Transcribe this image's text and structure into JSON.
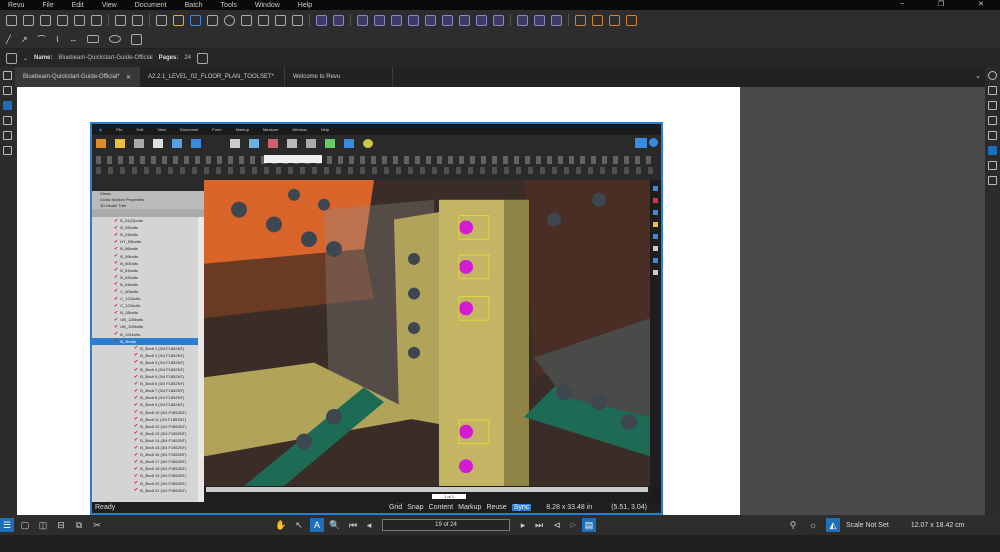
{
  "menu": [
    "Revu",
    "File",
    "Edit",
    "View",
    "Document",
    "Batch",
    "Tools",
    "Window",
    "Help"
  ],
  "file": {
    "name_label": "Name:",
    "name": "Bluebeam-Quickstart-Guide-Official",
    "pages_label": "Pages:",
    "pages": "24"
  },
  "tabs": [
    {
      "label": "Bluebeam-Quickstart-Guide-Official*",
      "close": "✕"
    },
    {
      "label": "A2.2.1_LEVEL_02_FLOOR_PLAN_TOOLSET*"
    },
    {
      "label": "Welcome to Revu"
    }
  ],
  "embedded": {
    "menu": [
      "File",
      "Edit",
      "View",
      "Document",
      "Form",
      "Markup",
      "Measure",
      "Window",
      "Help"
    ],
    "panel_sections": [
      "Views",
      "Cross Section Properties",
      "3D Model Tree"
    ],
    "view_tab": "Model1001b",
    "tree": [
      "B_51(2)bolts",
      "B_52bolts",
      "B_53bolts",
      "HY_55bolts",
      "B_56bolts",
      "B_59bolts",
      "B_60bolts",
      "B_61bolts",
      "B_62bolts",
      "B_63bolts",
      "C_60bolts",
      "C_121bolts",
      "C_122bolts",
      "B_28bolts",
      "UB_128bolts",
      "UB_109bolts",
      "B_191bolts",
      "B_3bolts"
    ],
    "subtree": [
      "B_3bolt 1 (3/4 F1852NT)",
      "B_3bolt 2 (3/4 F1852NT)",
      "B_3bolt 3 (3/4 F1852NT)",
      "B_3bolt 4 (3/4 F1852NT)",
      "B_3bolt 5 (3/4 F1852NT)",
      "B_3bolt 6 (3/4 F1852NT)",
      "B_3bolt 7 (3/4 F1852NT)",
      "B_3bolt 8 (3/4 F1852NT)",
      "B_3bolt 9 (3/4 F1852NT)",
      "B_3bolt 10 (3/4 F1852NT)",
      "B_3bolt 11 (3/4 F1852NT)",
      "B_3bolt 12 (3/4 F1852NT)",
      "B_3bolt 13 (3/4 F1852NT)",
      "B_3bolt 14 (3/4 F1852NT)",
      "B_3bolt 15 (3/4 F1852NT)",
      "B_3bolt 16 (3/4 F1852NT)",
      "B_3bolt 17 (3/4 F1852NT)",
      "B_3bolt 18 (3/4 F1852NT)",
      "B_3bolt 19 (3/4 F1852NT)",
      "B_3bolt 20 (3/4 F1852NT)",
      "B_3bolt 21 (3/4 F1852NT)"
    ],
    "status_left": "Ready",
    "status_items": [
      "Grid",
      "Snap",
      "Content",
      "Markup",
      "Reuse",
      "Sync"
    ],
    "dimensions": "8.28 x 33.48 in",
    "coords": "(5.51, 3.04)",
    "page_box": "1 of 1"
  },
  "status": {
    "page": "19 of 24",
    "scale": "Scale Not Set",
    "size": "12.07 x 18.42 cm"
  },
  "colors": {
    "accent": "#1c6fb8",
    "bolt": "#d21bd2",
    "steel": "#a89a55",
    "orange": "#d9652b",
    "green": "#1e6b55"
  }
}
